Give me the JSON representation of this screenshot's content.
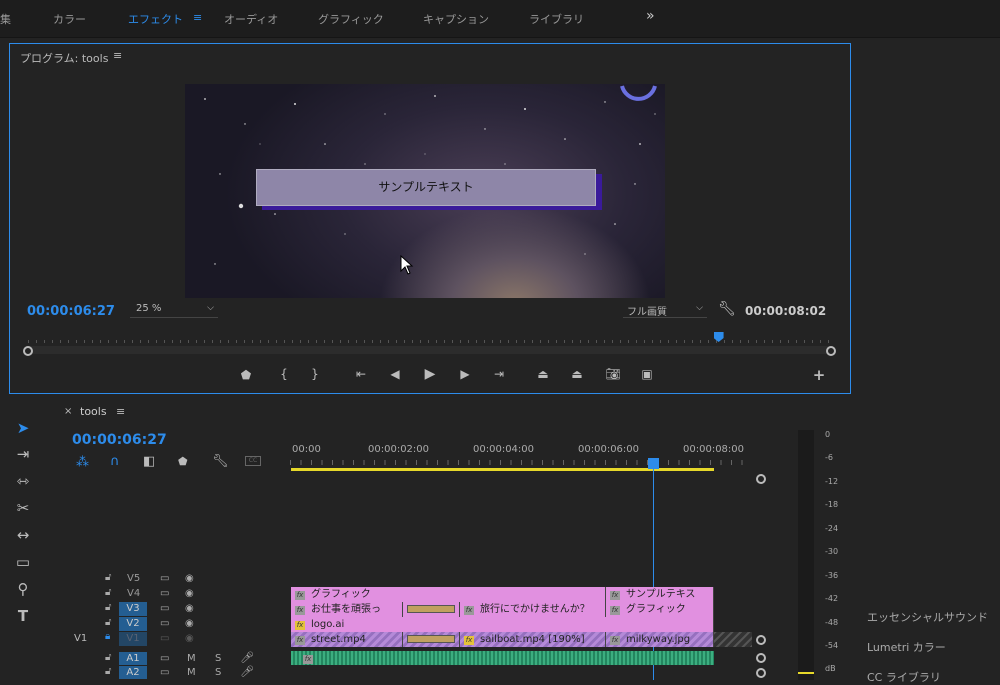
{
  "workspaces": {
    "items": [
      "集",
      "カラー",
      "エフェクト",
      "オーディオ",
      "グラフィック",
      "キャプション",
      "ライブラリ"
    ],
    "more": "»"
  },
  "program": {
    "title": "プログラム: tools",
    "menu": "≡",
    "timecode": "00:00:06:27",
    "zoom": "25 %",
    "quality": "フル画質",
    "duration": "00:00:08:02",
    "overlay_text": "サンプルテキスト",
    "add": "+",
    "playhead_fraction": 0.86
  },
  "timeline": {
    "close": "×",
    "title": "tools",
    "menu": "≡",
    "timecode": "00:00:06:27",
    "ruler": [
      "00:00",
      "00:00:02:00",
      "00:00:04:00",
      "00:00:06:00",
      "00:00:08:00"
    ],
    "tracks": [
      {
        "label": "V5",
        "clips": [
          {
            "name": "グラフィック",
            "fx": "grey"
          },
          {
            "name": "サンプルテキス",
            "fx": "grey"
          }
        ]
      },
      {
        "label": "V4",
        "clips": [
          {
            "name": "お仕事を頑張っ",
            "fx": "grey"
          },
          {
            "name": "",
            "fx": ""
          },
          {
            "name": "旅行にでかけませんか？",
            "fx": "grey"
          },
          {
            "name": "グラフィック",
            "fx": "grey"
          }
        ]
      },
      {
        "label": "V3",
        "clips": [
          {
            "name": "logo.ai",
            "fx": "yellow"
          }
        ]
      },
      {
        "label": "V2",
        "clips": [
          {
            "name": "street.mp4",
            "fx": "grey"
          },
          {
            "name": "",
            "fx": ""
          },
          {
            "name": "sailboat.mp4 [190%]",
            "fx": "yellow"
          },
          {
            "name": "milkyway.jpg",
            "fx": "grey"
          }
        ]
      },
      {
        "label": "V1",
        "clips": []
      },
      {
        "label": "A1",
        "audio": true
      },
      {
        "label": "A2",
        "audio": true
      }
    ],
    "source_patch": "V1",
    "mute": "M",
    "solo": "S"
  },
  "meter": {
    "labels": [
      "0",
      "-6",
      "-12",
      "-18",
      "-24",
      "-30",
      "-36",
      "-42",
      "-48",
      "-54",
      "dB"
    ]
  },
  "right_panel": {
    "items": [
      "エッセンシャルサウンド",
      "Lumetri カラー",
      "CC ライブラリ"
    ]
  }
}
